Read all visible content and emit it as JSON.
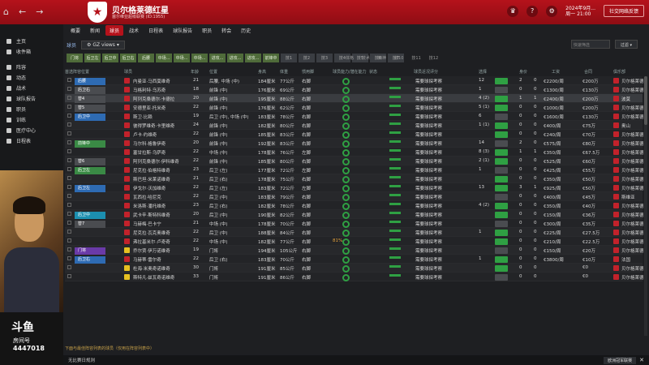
{
  "club": {
    "name": "贝尔格莱德红星",
    "subtitle": "塞尔维亚超级联赛 (ID:1955)",
    "crest": "★"
  },
  "header": {
    "date_line1": "2024年9月...",
    "date_line2": "周一 21:00",
    "social_label": "社交网络反馈"
  },
  "sidebar": {
    "items": [
      "主页",
      "收件箱",
      "阵容",
      "动态",
      "战术",
      "球队报告",
      "职员",
      "训练",
      "医疗中心",
      "日程表"
    ]
  },
  "tabs": [
    "概要",
    "新闻",
    "球员",
    "战术",
    "日程表",
    "球队报告",
    "职员",
    "转会",
    "历史"
  ],
  "active_tab": "球员",
  "subbar": {
    "label": "球员",
    "view": "GZ views"
  },
  "controls": {
    "quick_search_placeholder": "快速筛选",
    "filter_label": "过滤"
  },
  "filter_chips": [
    "门将",
    "后卫左",
    "后卫中",
    "后卫右",
    "后腰",
    "中场...",
    "中场...",
    "中场...",
    "进攻...",
    "进攻...",
    "进攻...",
    "前锋中",
    "技1",
    "技2",
    "技3",
    "技4",
    "技5",
    "技6",
    "技7"
  ],
  "grey_labels": [
    "体格",
    "技术",
    "精神",
    "技10",
    "技11",
    "技12"
  ],
  "columns": [
    "首选阵容位置",
    "球员",
    "年龄",
    "位置",
    "身高",
    "体重",
    "惯用脚",
    "球员能力/潜在能力",
    "状态",
    "球员近况评分",
    "选择",
    "身价",
    "工资",
    "合同",
    "俱乐部"
  ],
  "players": [
    {
      "pos": "后腰",
      "pc": "blue",
      "name": "内曼亚·马西莫维奇",
      "age": "21",
      "role": "后腰, 中场 (中)",
      "h": "184厘米",
      "w": "77公斤",
      "foot": "右脚",
      "pct": "",
      "rec": "需要球探考察",
      "apps": "12",
      "g": "2",
      "a": "0",
      "wage": "€2200/周",
      "value": "€200万",
      "club": "贝尔格莱德"
    },
    {
      "pos": "后卫右",
      "pc": "grey",
      "name": "马格利特·乌苏奇",
      "age": "18",
      "role": "前锋 (中)",
      "h": "176厘米",
      "w": "69公斤",
      "foot": "右脚",
      "pct": "",
      "rec": "需要球探考察",
      "apps": "1",
      "g": "0",
      "a": "0",
      "wage": "€1300/周",
      "value": "€130万",
      "club": "贝尔格莱德"
    },
    {
      "pos": "替4",
      "pc": "grey",
      "name": "阿列克桑德尔·卡德拉",
      "age": "20",
      "role": "前锋 (中)",
      "h": "195厘米",
      "w": "88公斤",
      "foot": "右脚",
      "pct": "",
      "rec": "需要球探考察",
      "apps": "4 (2)",
      "g": "1",
      "a": "1",
      "wage": "€2400/周",
      "value": "€200万",
      "club": "波莫"
    },
    {
      "pos": "替5",
      "pc": "grey",
      "name": "安德里亚·托米奇",
      "age": "22",
      "role": "前锋 (中)",
      "h": "176厘米",
      "w": "62公斤",
      "foot": "右脚",
      "pct": "",
      "rec": "需要球探考察",
      "apps": "5 (1)",
      "g": "0",
      "a": "0",
      "wage": "€1000/周",
      "value": "€200万",
      "club": "贝尔格莱德"
    },
    {
      "pos": "后卫中",
      "pc": "blue",
      "name": "斯卫·比赖",
      "age": "19",
      "role": "后卫 (中), 中场 (中)",
      "h": "183厘米",
      "w": "78公斤",
      "foot": "右脚",
      "pct": "",
      "rec": "需要球探考察",
      "apps": "6",
      "g": "0",
      "a": "0",
      "wage": "€1600/周",
      "value": "€130万",
      "club": "贝尔格莱德"
    },
    {
      "pos": "",
      "pc": "",
      "name": "彼得罗维奇·卡里维奇",
      "age": "24",
      "role": "前锋 (中)",
      "h": "182厘米",
      "w": "80公斤",
      "foot": "右脚",
      "pct": "",
      "rec": "需要球探考察",
      "apps": "1 (1)",
      "g": "0",
      "a": "0",
      "wage": "€400/周",
      "value": "€75万",
      "club": "奥山"
    },
    {
      "pos": "",
      "pc": "",
      "name": "卢卡·约维奇",
      "age": "22",
      "role": "前锋 (中)",
      "h": "185厘米",
      "w": "83公斤",
      "foot": "右脚",
      "pct": "",
      "rec": "需要球探考察",
      "apps": "",
      "g": "0",
      "a": "0",
      "wage": "€240/周",
      "value": "€70万",
      "club": "贝尔格莱德"
    },
    {
      "pos": "前锋中",
      "pc": "green",
      "name": "马尔科·格鲁伊奇",
      "age": "20",
      "role": "前锋 (中)",
      "h": "192厘米",
      "w": "83公斤",
      "foot": "右脚",
      "pct": "",
      "rec": "需要球探考察",
      "apps": "14",
      "g": "2",
      "a": "0",
      "wage": "€575/周",
      "value": "€80万",
      "club": "贝尔格莱德"
    },
    {
      "pos": "",
      "pc": "",
      "name": "塞甘拉斯·乌萨奇",
      "age": "22",
      "role": "中场 (中)",
      "h": "178厘米",
      "w": "76公斤",
      "foot": "左脚",
      "pct": "",
      "rec": "需要球探考察",
      "apps": "8 (3)",
      "g": "1",
      "a": "1",
      "wage": "€350/周",
      "value": "€67.5万",
      "club": "贝尔格莱德"
    },
    {
      "pos": "替6",
      "pc": "grey",
      "name": "阿列克桑德尔·伊科维奇",
      "age": "22",
      "role": "前锋 (中)",
      "h": "185厘米",
      "w": "80公斤",
      "foot": "右脚",
      "pct": "",
      "rec": "需要球探考察",
      "apps": "2 (1)",
      "g": "0",
      "a": "0",
      "wage": "€525/周",
      "value": "€60万",
      "club": "贝尔格莱德"
    },
    {
      "pos": "后卫左",
      "pc": "green",
      "name": "尼克拉·伯格特维奇",
      "age": "23",
      "role": "后卫 (左)",
      "h": "177厘米",
      "w": "72公斤",
      "foot": "左脚",
      "pct": "",
      "rec": "需要球探考察",
      "apps": "1",
      "g": "0",
      "a": "0",
      "wage": "€425/周",
      "value": "€55万",
      "club": "贝尔格莱德"
    },
    {
      "pos": "",
      "pc": "",
      "name": "斯巴坦·米莱诺维奇",
      "age": "21",
      "role": "后卫 (右)",
      "h": "178厘米",
      "w": "75公斤",
      "foot": "右脚",
      "pct": "",
      "rec": "需要球探考察",
      "apps": "",
      "g": "0",
      "a": "0",
      "wage": "€350/周",
      "value": "€50万",
      "club": "贝尔格莱德"
    },
    {
      "pos": "后卫左",
      "pc": "blue",
      "name": "伊戈尔·沃加维奇",
      "age": "22",
      "role": "后卫 (左)",
      "h": "183厘米",
      "w": "72公斤",
      "foot": "左脚",
      "pct": "",
      "rec": "需要球探考察",
      "apps": "13",
      "g": "3",
      "a": "1",
      "wage": "€925/周",
      "value": "€50万",
      "club": "贝尔格莱德"
    },
    {
      "pos": "",
      "pc": "",
      "name": "瓦西拉·哈尼克",
      "age": "22",
      "role": "后卫 (中)",
      "h": "183厘米",
      "w": "79公斤",
      "foot": "右脚",
      "pct": "",
      "rec": "需要球探考察",
      "apps": "",
      "g": "0",
      "a": "0",
      "wage": "€400/周",
      "value": "€45万",
      "club": "斯维亚"
    },
    {
      "pos": "",
      "pc": "",
      "name": "米洛斯·潘托维奇",
      "age": "23",
      "role": "后卫 (右)",
      "h": "182厘米",
      "w": "78公斤",
      "foot": "右脚",
      "pct": "",
      "rec": "需要球探考察",
      "apps": "4 (2)",
      "g": "0",
      "a": "0",
      "wage": "€350/周",
      "value": "€40万",
      "club": "贝尔格莱德"
    },
    {
      "pos": "后卫中",
      "pc": "cyan",
      "name": "武卡辛·斯特科维奇",
      "age": "20",
      "role": "后卫 (中)",
      "h": "190厘米",
      "w": "82公斤",
      "foot": "右脚",
      "pct": "",
      "rec": "需要球探考察",
      "apps": "",
      "g": "0",
      "a": "0",
      "wage": "€150/周",
      "value": "€36万",
      "club": "贝尔格莱德"
    },
    {
      "pos": "替7",
      "pc": "grey",
      "name": "马赫梅·巴卡宁",
      "age": "21",
      "role": "中场 (中)",
      "h": "178厘米",
      "w": "70公斤",
      "foot": "右脚",
      "pct": "",
      "rec": "需要球探考察",
      "apps": "",
      "g": "0",
      "a": "0",
      "wage": "€300/周",
      "value": "€35万",
      "club": "贝尔格莱德"
    },
    {
      "pos": "",
      "pc": "",
      "name": "尼克拉·瓦克奥维奇",
      "age": "22",
      "role": "后卫 (中)",
      "h": "188厘米",
      "w": "84公斤",
      "foot": "右脚",
      "pct": "",
      "rec": "需要球探考察",
      "apps": "1",
      "g": "0",
      "a": "0",
      "wage": "€225/周",
      "value": "€27.5万",
      "club": "贝尔格莱德"
    },
    {
      "pos": "",
      "pc": "",
      "name": "弗拉基米尔·卢奇奇",
      "age": "22",
      "role": "中场 (中)",
      "h": "182厘米",
      "w": "77公斤",
      "foot": "右脚",
      "pct": "81%",
      "rec": "需要球探考察",
      "apps": "",
      "g": "0",
      "a": "0",
      "wage": "€210/周",
      "value": "€22.5万",
      "club": "贝尔格莱德"
    },
    {
      "pos": "门将",
      "pc": "purple",
      "name": "乔尔贾·伊万诺维奇",
      "age": "19",
      "role": "门将",
      "h": "194厘米",
      "w": "105公斤",
      "foot": "右脚",
      "pct": "",
      "rec": "需要球探考察",
      "apps": "",
      "g": "0",
      "a": "0",
      "wage": "€150/周",
      "value": "€20万",
      "club": "贝尔格莱德"
    },
    {
      "pos": "后卫右",
      "pc": "blue",
      "name": "马赫蒂·雷尔奇",
      "age": "22",
      "role": "后卫 (右)",
      "h": "183厘米",
      "w": "70公斤",
      "foot": "右脚",
      "pct": "",
      "rec": "需要球探考察",
      "apps": "1",
      "g": "0",
      "a": "0",
      "wage": "€3800/周",
      "value": "€10万",
      "club": "法国"
    },
    {
      "pos": "",
      "pc": "",
      "name": "杜海·米奥奇诺维奇",
      "age": "30",
      "role": "门将",
      "h": "191厘米",
      "w": "85公斤",
      "foot": "右脚",
      "pct": "",
      "rec": "需要球探考察",
      "apps": "",
      "g": "0",
      "a": "0",
      "wage": "",
      "value": "€0",
      "club": "贝尔格莱德"
    },
    {
      "pos": "",
      "pc": "",
      "name": "斯特凡·兹瓦奇诺维奇",
      "age": "33",
      "role": "门将",
      "h": "191厘米",
      "w": "86公斤",
      "foot": "右脚",
      "pct": "",
      "rec": "需要球探考察",
      "apps": "",
      "g": "0",
      "a": "0",
      "wage": "",
      "value": "€0",
      "club": "贝尔格莱德"
    }
  ],
  "bottom_note": "下面与最佳阵容列表的球员（仅用在阵容列表中）",
  "status": {
    "text": "无比赛日规则",
    "right_btn": "欧洲冠军联赛"
  },
  "stream": {
    "logo": "斗鱼",
    "room_label": "房间号",
    "room_number": "4447018"
  }
}
